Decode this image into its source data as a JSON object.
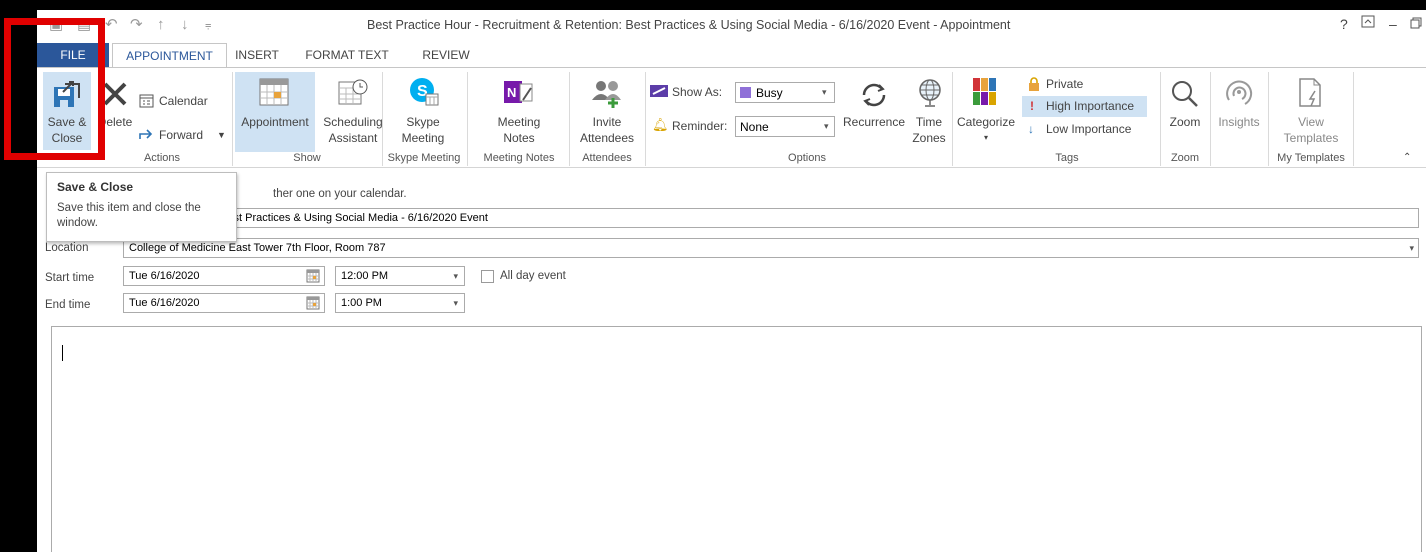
{
  "title_bar": {
    "title": "Best Practice Hour - Recruitment & Retention: Best Practices & Using Social Media - 6/16/2020 Event - Appointment",
    "help": "?",
    "minimize": "–",
    "close": "✕"
  },
  "tabs": [
    "FILE",
    "APPOINTMENT",
    "INSERT",
    "FORMAT TEXT",
    "REVIEW"
  ],
  "ribbon": {
    "actions": {
      "save_close_line1": "Save &",
      "save_close_line2": "Close",
      "delete": "Delete",
      "calendar": "Calendar",
      "forward": "Forward",
      "group": "Actions"
    },
    "show": {
      "appointment": "Appointment",
      "scheduling_line1": "Scheduling",
      "scheduling_line2": "Assistant",
      "group": "Show"
    },
    "skype": {
      "line1": "Skype",
      "line2": "Meeting",
      "group": "Skype Meeting"
    },
    "notes": {
      "line1": "Meeting",
      "line2": "Notes",
      "group": "Meeting Notes"
    },
    "attendees": {
      "line1": "Invite",
      "line2": "Attendees",
      "group": "Attendees"
    },
    "options": {
      "show_as_label": "Show As:",
      "show_as_value": "Busy",
      "reminder_label": "Reminder:",
      "reminder_value": "None",
      "recurrence": "Recurrence",
      "timezones_line1": "Time",
      "timezones_line2": "Zones",
      "group": "Options"
    },
    "tags": {
      "categorize": "Categorize",
      "private": "Private",
      "high": "High Importance",
      "low": "Low Importance",
      "group": "Tags"
    },
    "zoom": {
      "label": "Zoom",
      "group": "Zoom"
    },
    "insights": {
      "label": "Insights"
    },
    "templates": {
      "line1": "View",
      "line2": "Templates",
      "group": "My Templates"
    }
  },
  "form": {
    "info_text": "ther one on your calendar.",
    "subject_value": "ment & Retention: Best Practices & Using Social Media - 6/16/2020 Event",
    "location_label": "Location",
    "location_value": "College of Medicine East Tower 7th Floor, Room 787",
    "start_label": "Start time",
    "start_date": "Tue 6/16/2020",
    "start_time": "12:00 PM",
    "all_day": "All day event",
    "end_label": "End time",
    "end_date": "Tue 6/16/2020",
    "end_time": "1:00 PM"
  },
  "tooltip": {
    "title": "Save & Close",
    "body_line1": "Save this item and close the",
    "body_line2": "window."
  },
  "colors": {
    "file_tab": "#2b579a",
    "selected": "#cfe2f3",
    "highlight_box": "#e00000",
    "busy": "#8f70d8"
  }
}
